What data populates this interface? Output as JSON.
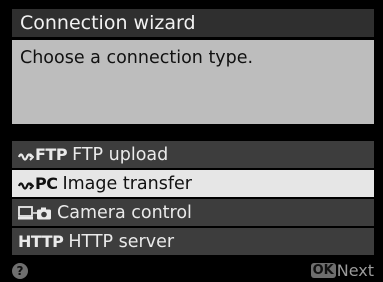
{
  "screen": {
    "title": "Connection wizard",
    "prompt": "Choose a connection type."
  },
  "menu": {
    "items": [
      {
        "tag": "FTP",
        "label": "FTP upload",
        "icon": "wifi-ftp-icon",
        "selected": false
      },
      {
        "tag": "PC",
        "label": "Image transfer",
        "icon": "wifi-pc-icon",
        "selected": true
      },
      {
        "tag": "",
        "label": "Camera control",
        "icon": "computer-camera-icon",
        "selected": false
      },
      {
        "tag": "HTTP",
        "label": "HTTP server",
        "icon": "http-icon",
        "selected": false
      }
    ]
  },
  "footer": {
    "help_symbol": "?",
    "ok_label": "OK",
    "next_label": "Next"
  },
  "colors": {
    "title_bar": "#2f2f2f",
    "prompt_box": "#bdbdbd",
    "menu_item": "#3d3d3d",
    "menu_item_selected": "#e6e6e6"
  }
}
